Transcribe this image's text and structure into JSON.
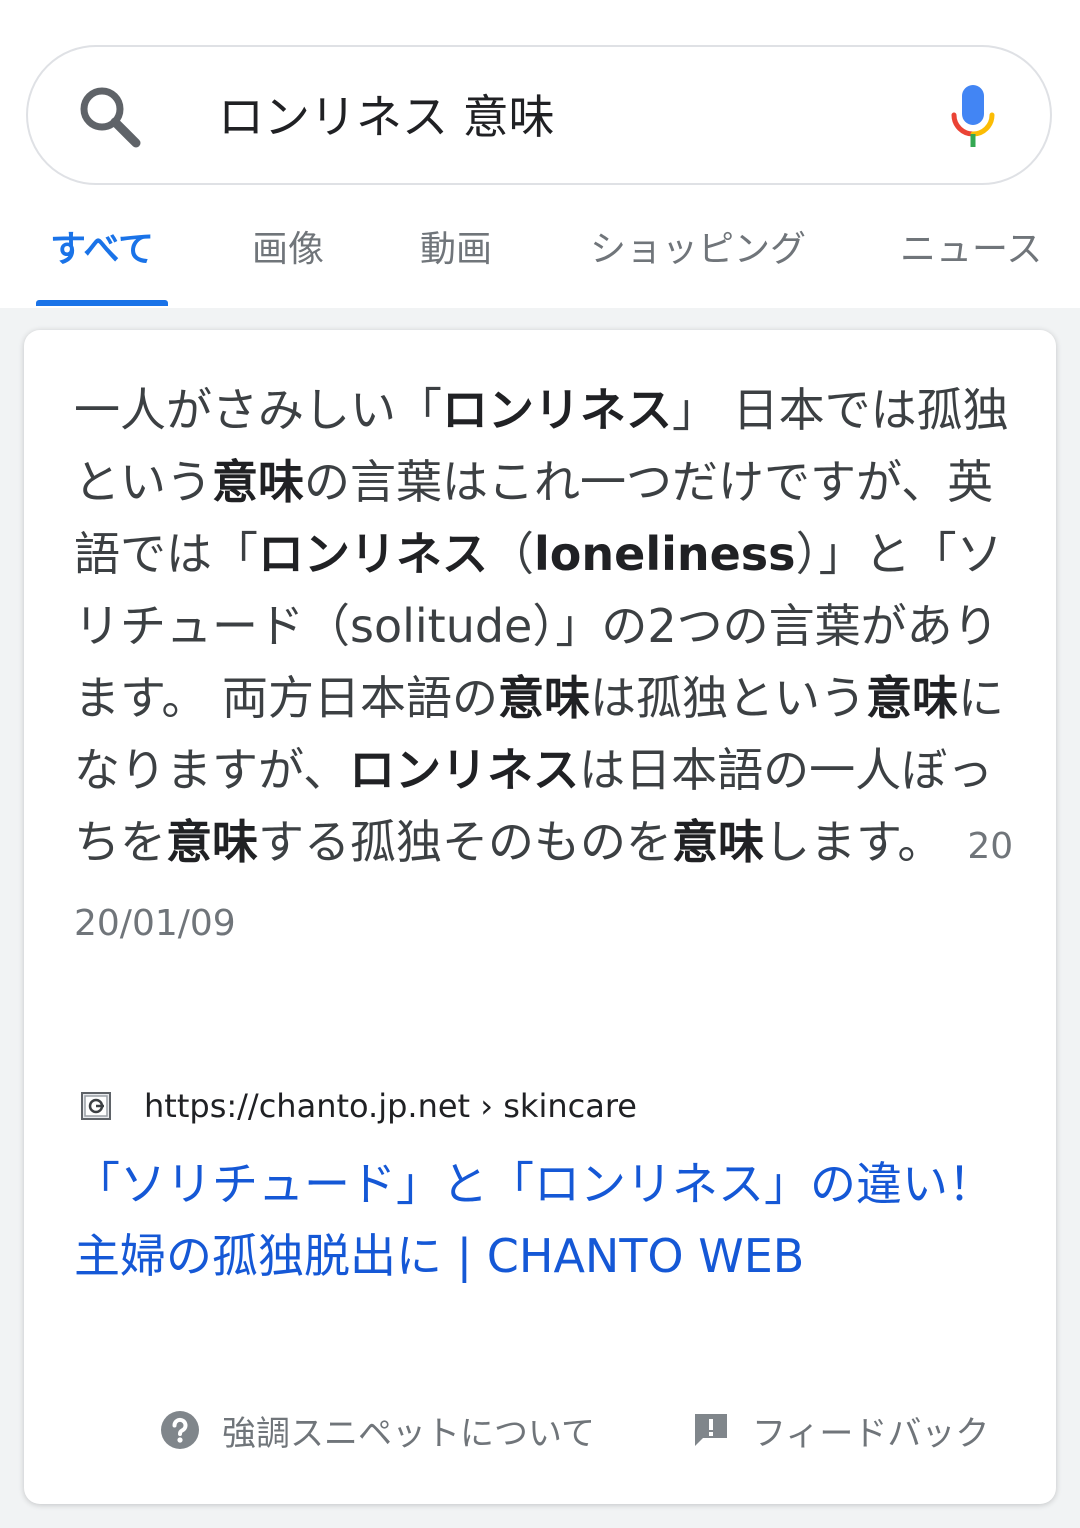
{
  "search": {
    "query": "ロンリネス 意味"
  },
  "tabs": [
    {
      "label": "すべて"
    },
    {
      "label": "画像"
    },
    {
      "label": "動画"
    },
    {
      "label": "ショッピング"
    },
    {
      "label": "ニュース"
    }
  ],
  "snippet": {
    "parts": [
      {
        "text": "一人がさみしい「",
        "bold": false
      },
      {
        "text": "ロンリネス",
        "bold": true
      },
      {
        "text": "」 日本では孤独という",
        "bold": false
      },
      {
        "text": "意味",
        "bold": true
      },
      {
        "text": "の言葉はこれ一つだけですが、英語では「",
        "bold": false
      },
      {
        "text": "ロンリネス",
        "bold": true
      },
      {
        "text": "（",
        "bold": false
      },
      {
        "text": "loneliness",
        "bold": true
      },
      {
        "text": "）」と「ソリチュード（solitude）」の2つの言葉があります。 両方日本語の",
        "bold": false
      },
      {
        "text": "意味",
        "bold": true
      },
      {
        "text": "は孤独という",
        "bold": false
      },
      {
        "text": "意味",
        "bold": true
      },
      {
        "text": "になりますが、",
        "bold": false
      },
      {
        "text": "ロンリネス",
        "bold": true
      },
      {
        "text": "は日本語の一人ぼっちを",
        "bold": false
      },
      {
        "text": "意味",
        "bold": true
      },
      {
        "text": "する孤独そのものを",
        "bold": false
      },
      {
        "text": "意味",
        "bold": true
      },
      {
        "text": "します。",
        "bold": false
      }
    ],
    "date": "2020/01/09"
  },
  "result": {
    "url": "https://chanto.jp.net › skincare",
    "title": "「ソリチュード」と「ロンリネス」の違い！主婦の孤独脱出に | CHANTO WEB"
  },
  "footer": {
    "about_label": "強調スニペットについて",
    "feedback_label": "フィードバック"
  },
  "colors": {
    "accent": "#1a73e8",
    "link": "#1558d6",
    "text": "#3c4043",
    "muted": "#70757a"
  }
}
